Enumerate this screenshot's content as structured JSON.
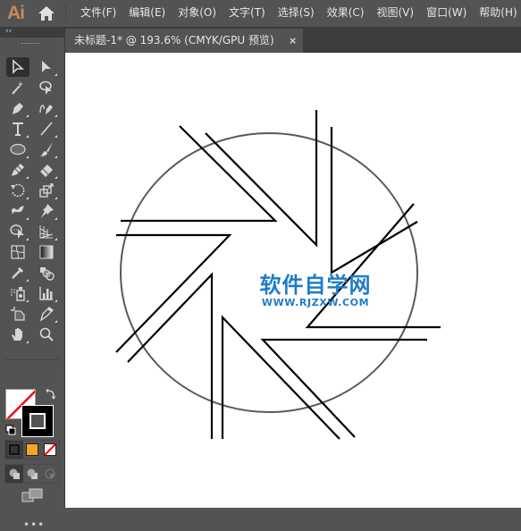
{
  "app": {
    "logo": "Ai",
    "home_icon": "home-icon"
  },
  "menu": {
    "items": [
      {
        "label": "文件(F)"
      },
      {
        "label": "编辑(E)"
      },
      {
        "label": "对象(O)"
      },
      {
        "label": "文字(T)"
      },
      {
        "label": "选择(S)"
      },
      {
        "label": "效果(C)"
      },
      {
        "label": "视图(V)"
      },
      {
        "label": "窗口(W)"
      },
      {
        "label": "帮助(H)"
      }
    ]
  },
  "panel": {
    "collapse_label": "‹‹",
    "tools": [
      {
        "name": "selection-tool",
        "icon": "arrow-outline-icon"
      },
      {
        "name": "direct-selection-tool",
        "icon": "arrow-filled-icon"
      },
      {
        "name": "magic-wand-tool",
        "icon": "magic-wand-icon"
      },
      {
        "name": "lasso-tool",
        "icon": "lasso-icon"
      },
      {
        "name": "pen-tool",
        "icon": "pen-icon"
      },
      {
        "name": "curvature-tool",
        "icon": "curvature-pen-icon"
      },
      {
        "name": "type-tool",
        "icon": "type-icon"
      },
      {
        "name": "line-segment-tool",
        "icon": "line-icon"
      },
      {
        "name": "ellipse-tool",
        "icon": "ellipse-icon"
      },
      {
        "name": "paintbrush-tool",
        "icon": "brush-icon"
      },
      {
        "name": "pencil-tool",
        "icon": "pencil-icon"
      },
      {
        "name": "eraser-tool",
        "icon": "eraser-icon"
      },
      {
        "name": "rotate-tool",
        "icon": "rotate-icon"
      },
      {
        "name": "scale-tool",
        "icon": "scale-icon"
      },
      {
        "name": "warp-tool",
        "icon": "warp-icon"
      },
      {
        "name": "puppet-warp-tool",
        "icon": "pin-icon"
      },
      {
        "name": "shape-builder-tool",
        "icon": "shape-builder-icon"
      },
      {
        "name": "perspective-grid-tool",
        "icon": "perspective-grid-icon"
      },
      {
        "name": "mesh-tool",
        "icon": "mesh-icon"
      },
      {
        "name": "gradient-tool",
        "icon": "gradient-icon"
      },
      {
        "name": "eyedropper-tool",
        "icon": "eyedropper-icon"
      },
      {
        "name": "blend-tool",
        "icon": "blend-icon"
      },
      {
        "name": "symbol-sprayer-tool",
        "icon": "symbol-sprayer-icon"
      },
      {
        "name": "column-graph-tool",
        "icon": "bar-chart-icon"
      },
      {
        "name": "artboard-tool",
        "icon": "artboard-icon"
      },
      {
        "name": "slice-tool",
        "icon": "knife-icon"
      },
      {
        "name": "hand-tool",
        "icon": "hand-icon"
      },
      {
        "name": "zoom-tool",
        "icon": "magnifier-icon"
      }
    ],
    "fill_color": "none",
    "stroke_color": "#000000",
    "mode_swatches": [
      "#000000",
      "#f5a623",
      "none"
    ],
    "more_label": "•••"
  },
  "document": {
    "tab_title": "未标题-1* @ 193.6% (CMYK/GPU 预览)",
    "close_label": "×",
    "zoom": "193.6%",
    "color_mode": "CMYK/GPU 预览"
  },
  "watermark": {
    "title": "软件自学网",
    "url": "WWW.RJZXW.COM",
    "color": "#1f7cc8"
  },
  "colors": {
    "ui_bg": "#535353",
    "tab_bar_bg": "#3c3c3c",
    "canvas_bg": "#ffffff",
    "logo": "#c58a5b",
    "circle_stroke": "#595959",
    "line_stroke": "#000000"
  }
}
